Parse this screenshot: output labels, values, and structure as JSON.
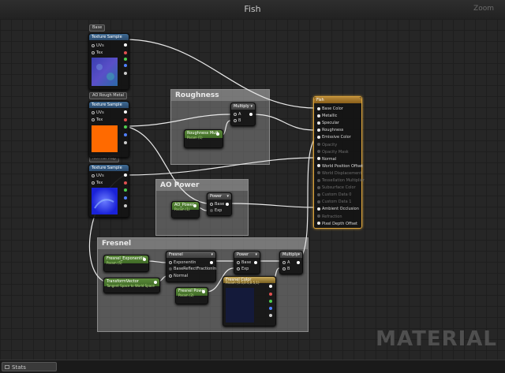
{
  "window": {
    "title": "Fish",
    "zoom": "Zoom"
  },
  "statusbar": {
    "tab_label": "Stats"
  },
  "watermark": "MATERIAL",
  "comments": {
    "roughness": "Roughness",
    "ao_power": "AO Power",
    "fresnel": "Fresnel"
  },
  "labels": {
    "base": "Base",
    "ao_rough_metal": "AO Rough Metal",
    "normal_map": "Normal Map"
  },
  "texture_sample": {
    "title": "Texture Sample",
    "uvs": "UVs",
    "tex": "Tex"
  },
  "nodes": {
    "multiply": "Multiply",
    "pin_a": "A",
    "pin_b": "B",
    "roughness_mult": "Roughness Mult",
    "roughness_mult_param": "Param (1)",
    "power": "Power",
    "pin_base": "Base",
    "pin_exp": "Exp",
    "ao_power": "AO_Power",
    "ao_power_param": "Param (1)",
    "fresnel_exponentin": "Fresnel_ExponentIn",
    "fresnel_exponentin_param": "Param (5)",
    "fresnel": "Fresnel",
    "exponentin": "ExponentIn",
    "basereflectfractionin": "BaseReflectFractionIn",
    "normal": "Normal",
    "power2": "Power",
    "transform_vector": "TransformVector",
    "transform_vector_sub": "Tangent Space to World Space",
    "fresnel_power": "Fresnel Power",
    "fresnel_power_param": "Param (2)",
    "fresnel_color": "Fresnel Color",
    "fresnel_color_param": "Param (0.5,0.5,0.5,1)",
    "multiply2": "Multiply"
  },
  "material_node": {
    "title": "Fish",
    "inputs": [
      {
        "label": "Base Color",
        "active": true
      },
      {
        "label": "Metallic",
        "active": true
      },
      {
        "label": "Specular",
        "active": true
      },
      {
        "label": "Roughness",
        "active": true
      },
      {
        "label": "Emissive Color",
        "active": true
      },
      {
        "label": "Opacity",
        "active": false
      },
      {
        "label": "Opacity Mask",
        "active": false
      },
      {
        "label": "Normal",
        "active": true
      },
      {
        "label": "World Position Offset",
        "active": true
      },
      {
        "label": "World Displacement",
        "active": false
      },
      {
        "label": "Tessellation Multiplier",
        "active": false
      },
      {
        "label": "Subsurface Color",
        "active": false
      },
      {
        "label": "Custom Data 0",
        "active": false
      },
      {
        "label": "Custom Data 1",
        "active": false
      },
      {
        "label": "Ambient Occlusion",
        "active": true
      },
      {
        "label": "Refraction",
        "active": false
      },
      {
        "label": "Pixel Depth Offset",
        "active": true
      }
    ]
  },
  "colors": {
    "texture_header": "#2a4a6c",
    "param_header": "#3f6a26",
    "material_border": "#d9a23b",
    "orange_preview": "#ff6a00"
  }
}
